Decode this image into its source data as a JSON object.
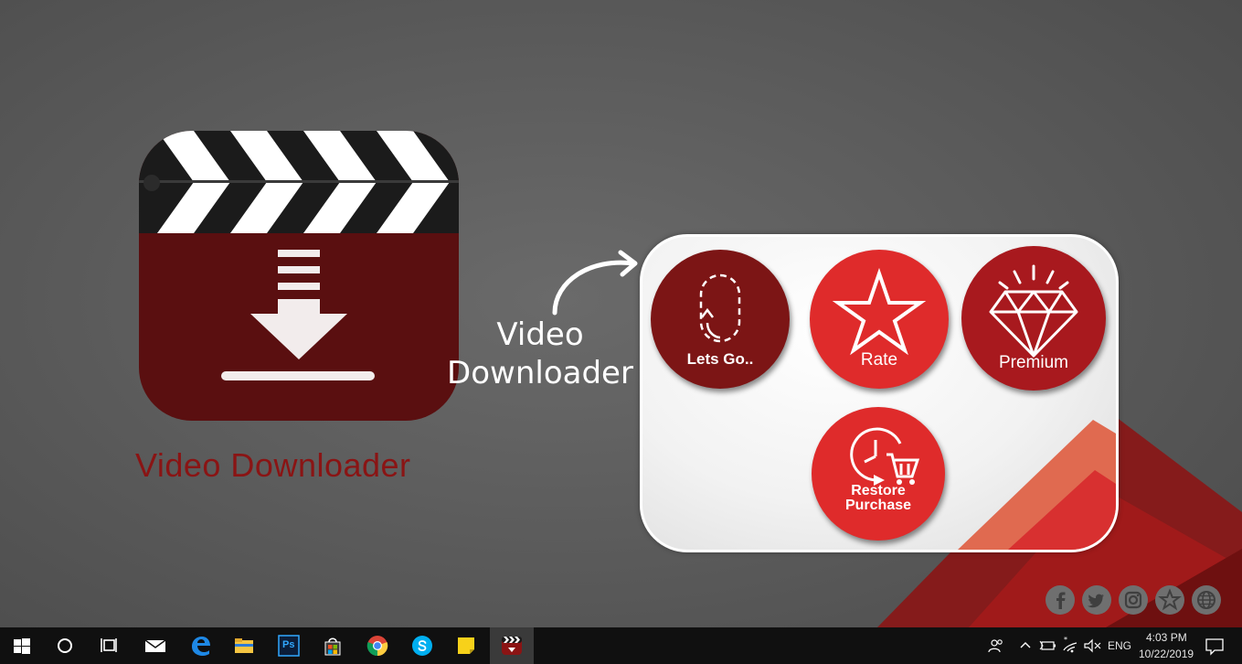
{
  "app": {
    "caption": "Video Downloader",
    "callout_line1": "Video",
    "callout_line2": "Downloader"
  },
  "menu": {
    "lets_go_label": "Lets Go..",
    "rate_label": "Rate",
    "premium_label": "Premium",
    "restore_line1": "Restore",
    "restore_line2": "Purchase"
  },
  "social": [
    "facebook-icon",
    "twitter-icon",
    "instagram-icon",
    "star-icon",
    "globe-icon"
  ],
  "colors": {
    "brand_red": "#df2b2b",
    "dark_red": "#7c1515",
    "premium_red": "#a8191e",
    "logo_red": "#5c1010"
  },
  "taskbar": {
    "apps": [
      "start-icon",
      "cortana-icon",
      "task-view-icon",
      "mail-icon",
      "edge-icon",
      "file-explorer-icon",
      "photoshop-icon",
      "store-icon",
      "chrome-icon",
      "skype-icon",
      "sticky-notes-icon",
      "video-downloader-icon"
    ],
    "photoshop_text": "Ps",
    "language": "ENG",
    "time": "4:03 PM",
    "date": "10/22/2019"
  }
}
